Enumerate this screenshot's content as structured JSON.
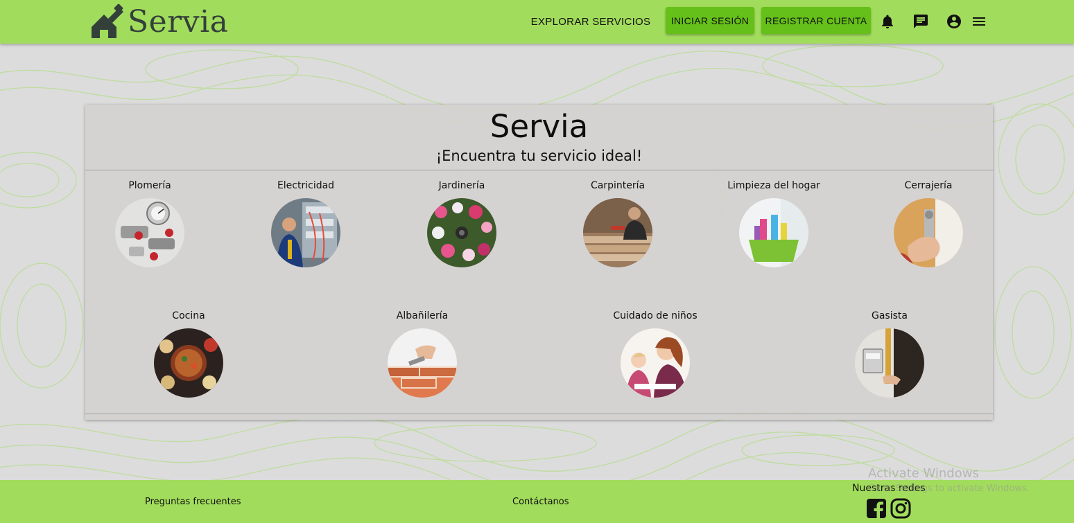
{
  "header": {
    "brand": "Servia",
    "nav_explore": "EXPLORAR SERVICIOS",
    "login_label": "INICIAR SESIÓN",
    "register_label": "REGISTRAR CUENTA",
    "icons": [
      "bell-icon",
      "chat-icon",
      "account-circle-icon",
      "menu-icon"
    ]
  },
  "hero": {
    "title": "Servia",
    "subtitle": "¡Encuentra tu servicio ideal!"
  },
  "services": {
    "row1": [
      {
        "label": "Plomería",
        "image": "plumbing-fittings"
      },
      {
        "label": "Electricidad",
        "image": "electrician-panel"
      },
      {
        "label": "Jardinería",
        "image": "flowers"
      },
      {
        "label": "Carpintería",
        "image": "carpenter-workshop"
      },
      {
        "label": "Limpieza del hogar",
        "image": "cleaning-supplies"
      },
      {
        "label": "Cerrajería",
        "image": "door-lock"
      }
    ],
    "row2": [
      {
        "label": "Cocina",
        "image": "cooked-food"
      },
      {
        "label": "Albañilería",
        "image": "brick-laying"
      },
      {
        "label": "Cuidado de niños",
        "image": "childcare"
      },
      {
        "label": "Gasista",
        "image": "gas-meter"
      }
    ]
  },
  "footer": {
    "faq": "Preguntas frecuentes",
    "contact": "Contáctanos",
    "social_title": "Nuestras redes",
    "social_icons": [
      "facebook-icon",
      "instagram-icon"
    ]
  },
  "watermark": {
    "title": "Activate Windows",
    "subtitle": "Go to Settings to activate Windows."
  },
  "colors": {
    "header_bg": "#a2dc5c",
    "button_bg": "#65c01a",
    "page_bg": "#dcdcdc",
    "pattern_line": "#a8d97a"
  }
}
